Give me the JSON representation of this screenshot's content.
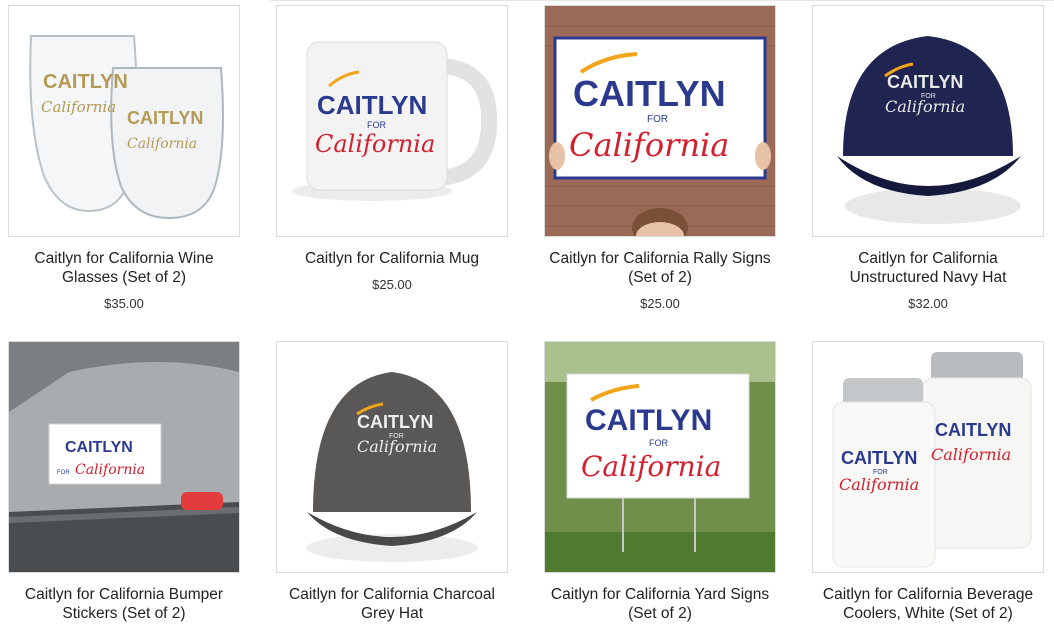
{
  "products": [
    {
      "title": "Caitlyn for California Wine Glasses (Set of 2)",
      "price": "$35.00",
      "image_icon": "wine-glasses-image"
    },
    {
      "title": "Caitlyn for California Mug",
      "price": "$25.00",
      "image_icon": "mug-image"
    },
    {
      "title": "Caitlyn for California Rally Signs (Set of 2)",
      "price": "$25.00",
      "image_icon": "rally-sign-image"
    },
    {
      "title": "Caitlyn for California Unstructured Navy Hat",
      "price": "$32.00",
      "image_icon": "navy-hat-image"
    },
    {
      "title": "Caitlyn for California Bumper Stickers (Set of 2)",
      "image_icon": "bumper-sticker-image"
    },
    {
      "title": "Caitlyn for California Charcoal Grey Hat",
      "image_icon": "charcoal-hat-image"
    },
    {
      "title": "Caitlyn for California Yard Signs (Set of 2)",
      "image_icon": "yard-sign-image"
    },
    {
      "title": "Caitlyn for California Beverage Coolers, White (Set of 2)",
      "image_icon": "beverage-cooler-image"
    }
  ],
  "logo": {
    "name": "CAITLYN",
    "for": "FOR",
    "state": "California"
  },
  "colors": {
    "brand_blue": "#2b3a8f",
    "brand_red": "#d2202f",
    "gold": "#b59a55",
    "star": "#f2a51a"
  }
}
